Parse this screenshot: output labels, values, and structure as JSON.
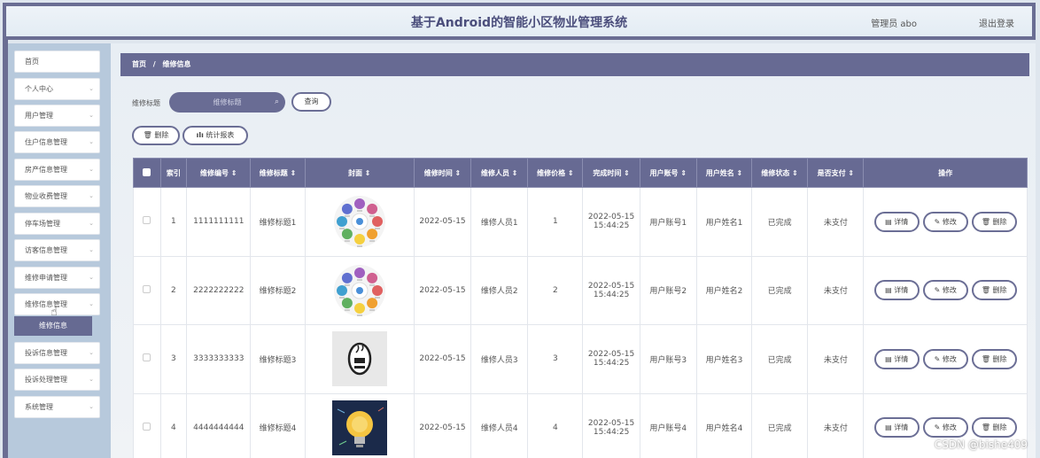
{
  "header": {
    "title": "基于Android的智能小区物业管理系统",
    "user": "管理员 abo",
    "logout": "退出登录"
  },
  "sidebar": {
    "items": [
      {
        "label": "首页",
        "has_arrow": false
      },
      {
        "label": "个人中心",
        "has_arrow": true
      },
      {
        "label": "用户管理",
        "has_arrow": true
      },
      {
        "label": "住户信息管理",
        "has_arrow": true
      },
      {
        "label": "房产信息管理",
        "has_arrow": true
      },
      {
        "label": "物业收费管理",
        "has_arrow": true
      },
      {
        "label": "停车场管理",
        "has_arrow": true
      },
      {
        "label": "访客信息管理",
        "has_arrow": true
      },
      {
        "label": "维修申请管理",
        "has_arrow": true
      },
      {
        "label": "维修信息管理",
        "has_arrow": true
      },
      {
        "label": "投诉信息管理",
        "has_arrow": true
      },
      {
        "label": "投诉处理管理",
        "has_arrow": true
      },
      {
        "label": "系统管理",
        "has_arrow": true
      }
    ],
    "active_sub": "维修信息"
  },
  "breadcrumb": {
    "home": "首页",
    "sep": "/",
    "current": "维修信息"
  },
  "search": {
    "label": "维修标题",
    "placeholder": "维修标题",
    "button": "查询"
  },
  "actions": {
    "delete": "删除",
    "stats": "统计报表"
  },
  "table": {
    "columns": [
      "索引",
      "维修编号 ⇕",
      "维修标题 ⇕",
      "封面 ⇕",
      "维修时间 ⇕",
      "维修人员 ⇕",
      "维修价格 ⇕",
      "完成时间 ⇕",
      "用户账号 ⇕",
      "用户姓名 ⇕",
      "维修状态 ⇕",
      "是否支付 ⇕",
      "操作"
    ],
    "rows": [
      {
        "index": "1",
        "code": "1111111111",
        "title": "维修标题1",
        "cover": "cycle",
        "time": "2022-05-15",
        "staff": "维修人员1",
        "price": "1",
        "done_date": "2022-05-15",
        "done_time": "15:44:25",
        "account": "用户账号1",
        "name": "用户姓名1",
        "status": "已完成",
        "paid": "未支付"
      },
      {
        "index": "2",
        "code": "2222222222",
        "title": "维修标题2",
        "cover": "cycle",
        "time": "2022-05-15",
        "staff": "维修人员2",
        "price": "2",
        "done_date": "2022-05-15",
        "done_time": "15:44:25",
        "account": "用户账号2",
        "name": "用户姓名2",
        "status": "已完成",
        "paid": "未支付"
      },
      {
        "index": "3",
        "code": "3333333333",
        "title": "维修标题3",
        "cover": "java",
        "time": "2022-05-15",
        "staff": "维修人员3",
        "price": "3",
        "done_date": "2022-05-15",
        "done_time": "15:44:25",
        "account": "用户账号3",
        "name": "用户姓名3",
        "status": "已完成",
        "paid": "未支付"
      },
      {
        "index": "4",
        "code": "4444444444",
        "title": "维修标题4",
        "cover": "bulb",
        "time": "2022-05-15",
        "staff": "维修人员4",
        "price": "4",
        "done_date": "2022-05-15",
        "done_time": "15:44:25",
        "account": "用户账号4",
        "name": "用户姓名4",
        "status": "已完成",
        "paid": "未支付"
      }
    ],
    "ops": {
      "detail": "详情",
      "edit": "修改",
      "delete": "删除"
    }
  },
  "watermark": "CSDN @bishe409",
  "colors": {
    "primary": "#676a93",
    "sidebar_bg": "#b7c9dc"
  }
}
